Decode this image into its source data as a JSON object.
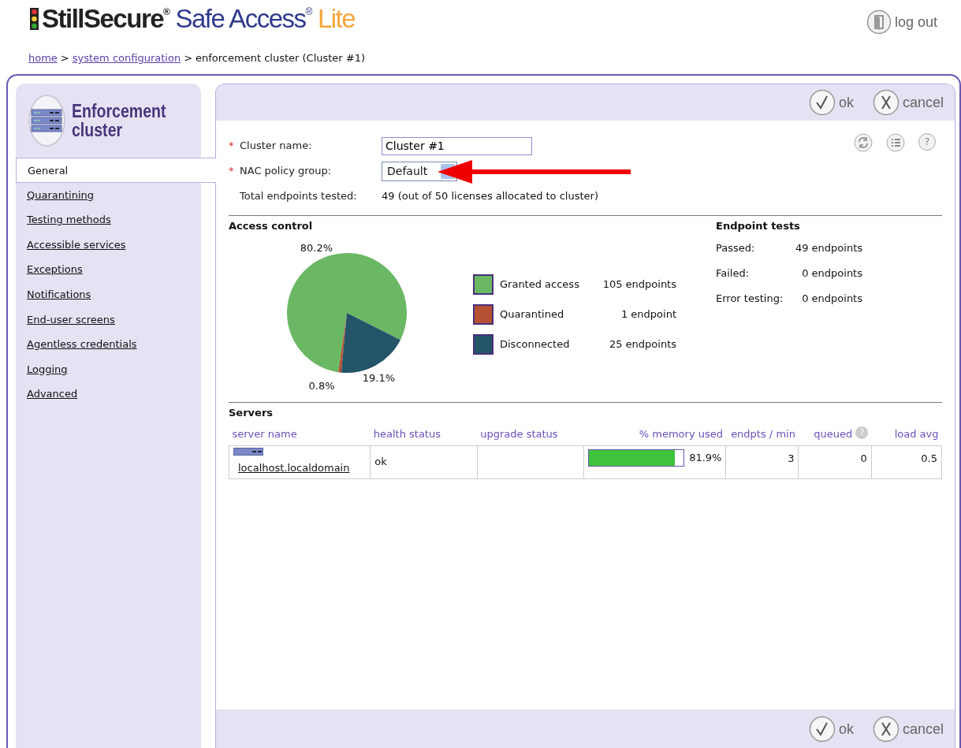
{
  "header": {
    "brand": "StillSecure$^{®}$",
    "product": "Safe Access$^{®}$",
    "edition": "Lite",
    "logout": "log out"
  },
  "breadcrumb": [
    {
      "label": "home",
      "kind": "link"
    },
    {
      "label": ">",
      "kind": "sep"
    },
    {
      "label": "system configuration",
      "kind": "link"
    },
    {
      "label": ">",
      "kind": "sep"
    },
    {
      "label": "enforcement cluster (Cluster #1)",
      "kind": "current"
    }
  ],
  "sidebar": {
    "title": "Enforcement cluster",
    "items": [
      {
        "label": "General",
        "selected": true
      },
      {
        "label": "Quarantining",
        "selected": false
      },
      {
        "label": "Testing methods",
        "selected": false
      },
      {
        "label": "Accessible services",
        "selected": false
      },
      {
        "label": "Exceptions",
        "selected": false
      },
      {
        "label": "Notifications",
        "selected": false
      },
      {
        "label": "End-user screens",
        "selected": false
      },
      {
        "label": "Agentless credentials",
        "selected": false
      },
      {
        "label": "Logging",
        "selected": false
      },
      {
        "label": "Advanced",
        "selected": false
      }
    ]
  },
  "top_toolbar": {
    "buttons": [
      {
        "label": "ok",
        "kind": "ok"
      },
      {
        "label": "cancel",
        "kind": "cancel"
      }
    ]
  },
  "tool_icons": {
    "help_glyph": "?"
  },
  "form": {
    "fields": [
      {
        "label": "Cluster name:",
        "mark": "*",
        "kind": "text",
        "value": "Cluster #1"
      },
      {
        "label": "NAC policy group:",
        "mark": "*",
        "kind": "select",
        "value": "Default"
      },
      {
        "label": "Total endpoints tested:",
        "kind": "static",
        "value": "49 (out of 50 licenses allocated to cluster)"
      }
    ]
  },
  "access_control": {
    "title": "Access control",
    "chart_data": {
      "type": "pie",
      "categories": [
        "Granted access",
        "Quarantined",
        "Disconnected"
      ],
      "values": [
        80.2,
        0.8,
        19.1
      ],
      "value_labels": [
        "80.2%",
        "0.8%",
        "19.1%"
      ]
    },
    "legend": [
      {
        "count": "105 endpoints",
        "color": "#6ab864"
      },
      {
        "count": "1 endpoint",
        "color": "#b45034"
      },
      {
        "count": "25 endpoints",
        "color": "#245468"
      }
    ]
  },
  "endpoint_tests": {
    "title": "Endpoint tests",
    "rows": [
      {
        "label": "Passed:",
        "value": "49 endpoints"
      },
      {
        "label": "Failed:",
        "value": "0 endpoints"
      },
      {
        "label": "Error testing:",
        "value": "0 endpoints"
      }
    ]
  },
  "servers": {
    "title": "Servers",
    "columns": [
      {
        "label": "server name"
      },
      {
        "label": "health status"
      },
      {
        "label": "upgrade status"
      },
      {
        "label": "% memory used"
      },
      {
        "label": "endpts / min"
      },
      {
        "label": "queued",
        "help": "?"
      },
      {
        "label": "load avg"
      }
    ],
    "rows": [
      {
        "server_name": "localhost.localdomain",
        "health_status": "ok",
        "memory": {
          "level": 0.91,
          "reading": "81.9%"
        },
        "endpts_per_min": "3",
        "queued": "0",
        "load_avg": "0.5"
      }
    ]
  },
  "bottom_toolbar": {
    "buttons": [
      {
        "label": "ok",
        "kind": "ok"
      },
      {
        "label": "cancel",
        "kind": "cancel"
      }
    ]
  }
}
